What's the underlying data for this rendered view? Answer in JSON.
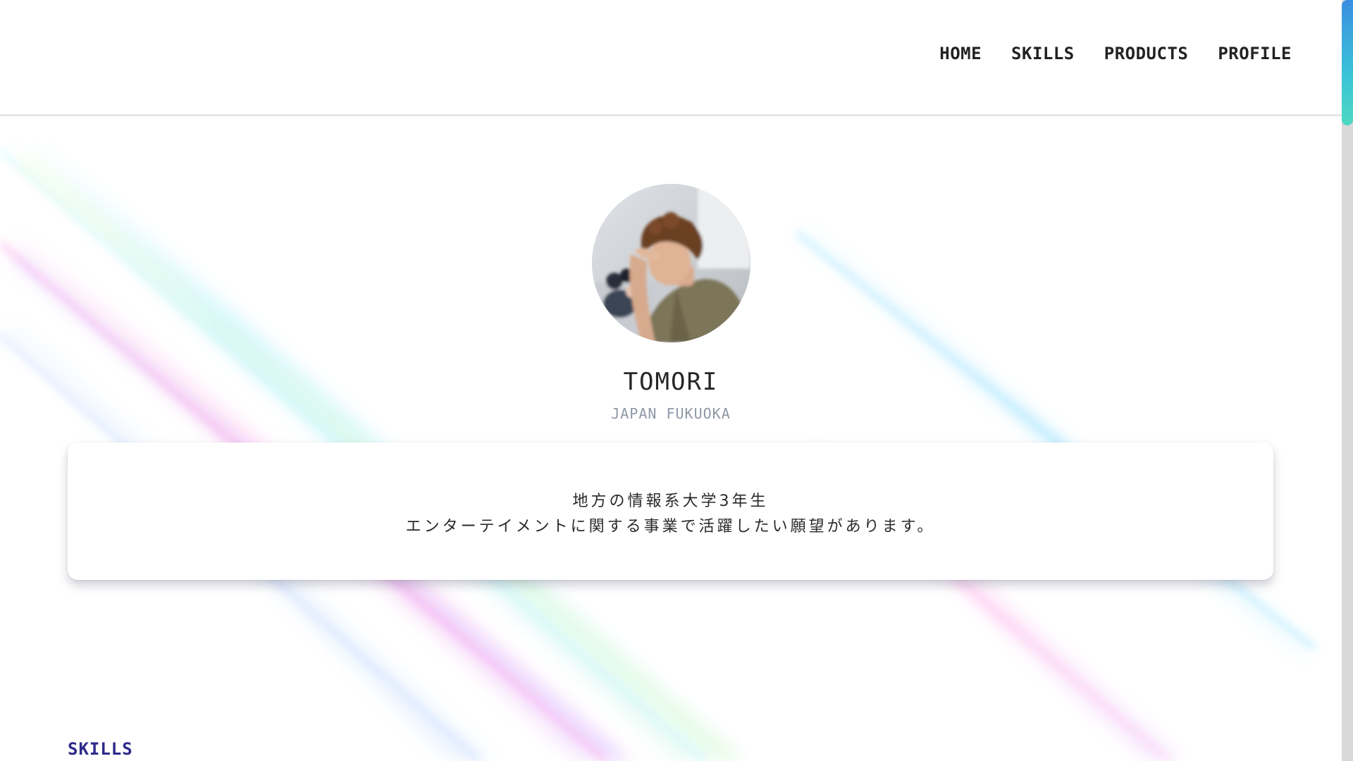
{
  "nav": {
    "items": [
      {
        "label": "HOME"
      },
      {
        "label": "SKILLS"
      },
      {
        "label": "PRODUCTS"
      },
      {
        "label": "PROFILE"
      }
    ]
  },
  "profile": {
    "name": "TOMORI",
    "location": "JAPAN FUKUOKA",
    "bio": [
      "地方の情報系大学3年生",
      "エンターテイメントに関する事業で活躍したい願望があります。"
    ]
  },
  "sections": {
    "skills_title": "SKILLS"
  },
  "colors": {
    "section_title": "#2d2a8a",
    "location_text": "#8e98a8",
    "scrollbar_accent": "#39c3d8"
  }
}
